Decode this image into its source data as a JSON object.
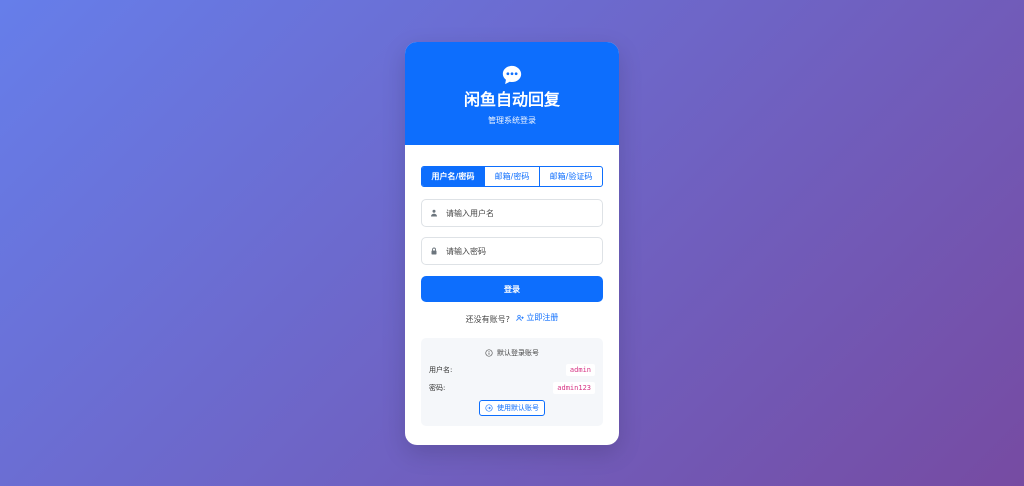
{
  "header": {
    "logo_icon": "chat-dots-icon",
    "title": "闲鱼自动回复",
    "subtitle": "管理系统登录"
  },
  "tabs": [
    {
      "label": "用户名/密码",
      "active": true
    },
    {
      "label": "邮箱/密码",
      "active": false
    },
    {
      "label": "邮箱/验证码",
      "active": false
    }
  ],
  "form": {
    "username_placeholder": "请输入用户名",
    "username_icon": "person-icon",
    "password_placeholder": "请输入密码",
    "password_icon": "lock-icon",
    "login_label": "登录"
  },
  "register": {
    "prompt": "还没有账号?",
    "link_label": "立即注册",
    "link_icon": "person-plus-icon"
  },
  "default_account": {
    "title": "默认登录账号",
    "title_icon": "info-circle-icon",
    "username_label": "用户名:",
    "username_value": "admin",
    "password_label": "密码:",
    "password_value": "admin123",
    "use_button_label": "使用默认账号",
    "use_button_icon": "arrow-circle-icon"
  },
  "colors": {
    "primary": "#0d6efd",
    "bg_gradient_start": "#667eea",
    "bg_gradient_end": "#764ba2",
    "code": "#d63384"
  }
}
